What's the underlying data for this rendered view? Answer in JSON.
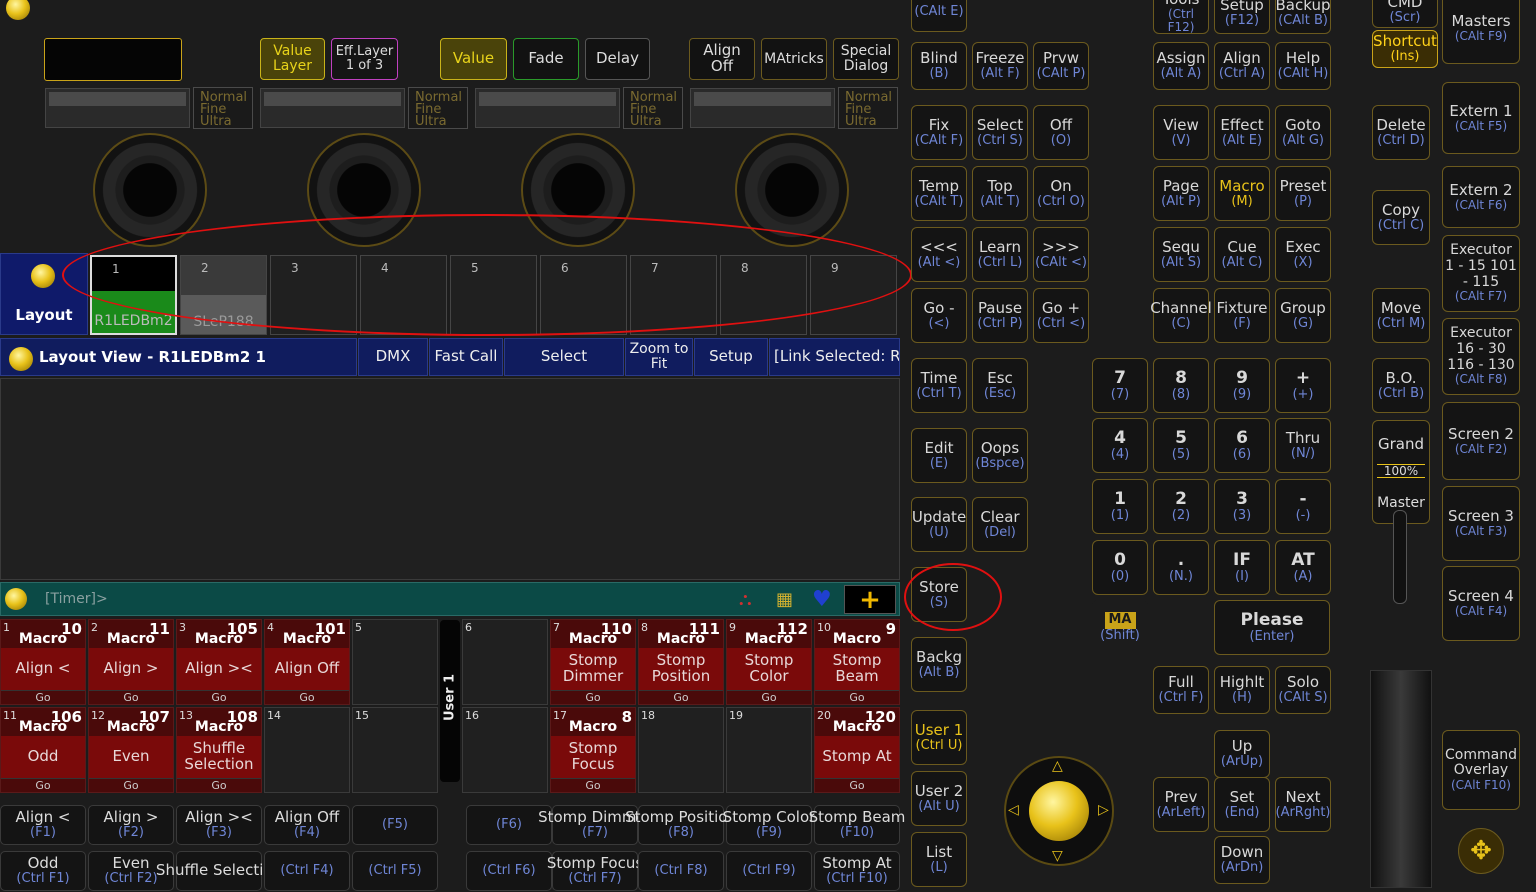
{
  "encoder": {
    "display_box": "",
    "value_layer": "Value Layer",
    "eff_layer": "Eff.Layer 1 of 3",
    "value": "Value",
    "fade": "Fade",
    "delay": "Delay",
    "align_off": "Align Off",
    "matricks": "MAtricks",
    "special_dialog": "Special Dialog",
    "res_text": "Normal Fine Ultra"
  },
  "layout_pool": {
    "label": "Layout",
    "items": [
      {
        "num": "1",
        "name": "R1LEDBm2"
      },
      {
        "num": "2",
        "name": "SLeP188"
      },
      {
        "num": "3",
        "name": ""
      },
      {
        "num": "4",
        "name": ""
      },
      {
        "num": "5",
        "name": ""
      },
      {
        "num": "6",
        "name": ""
      },
      {
        "num": "7",
        "name": ""
      },
      {
        "num": "8",
        "name": ""
      },
      {
        "num": "9",
        "name": ""
      }
    ]
  },
  "layout_view": {
    "title": "Layout View - R1LEDBm2 1",
    "tabs": [
      "DMX",
      "Fast Call",
      "Select",
      "Zoom to Fit",
      "Setup",
      "[Link Selected: R"
    ]
  },
  "executor_bar": {
    "timer": "[Timer]>",
    "user_label": "User 1",
    "row1": [
      {
        "num": "1",
        "id": "10",
        "type": "Macro",
        "action": "Align <",
        "go": "Go"
      },
      {
        "num": "2",
        "id": "11",
        "type": "Macro",
        "action": "Align >",
        "go": "Go"
      },
      {
        "num": "3",
        "id": "105",
        "type": "Macro",
        "action": "Align ><",
        "go": "Go"
      },
      {
        "num": "4",
        "id": "101",
        "type": "Macro",
        "action": "Align Off",
        "go": "Go"
      },
      {
        "num": "5",
        "id": "",
        "type": "",
        "action": "",
        "go": ""
      },
      {
        "num": "6",
        "id": "",
        "type": "",
        "action": "",
        "go": ""
      },
      {
        "num": "7",
        "id": "110",
        "type": "Macro",
        "action": "Stomp Dimmer",
        "go": "Go"
      },
      {
        "num": "8",
        "id": "111",
        "type": "Macro",
        "action": "Stomp Position",
        "go": "Go"
      },
      {
        "num": "9",
        "id": "112",
        "type": "Macro",
        "action": "Stomp Color",
        "go": "Go"
      },
      {
        "num": "10",
        "id": "9",
        "type": "Macro",
        "action": "Stomp Beam",
        "go": "Go"
      }
    ],
    "row2": [
      {
        "num": "11",
        "id": "106",
        "type": "Macro",
        "action": "Odd",
        "go": "Go"
      },
      {
        "num": "12",
        "id": "107",
        "type": "Macro",
        "action": "Even",
        "go": "Go"
      },
      {
        "num": "13",
        "id": "108",
        "type": "Macro",
        "action": "Shuffle Selection",
        "go": "Go"
      },
      {
        "num": "14",
        "id": "",
        "type": "",
        "action": "",
        "go": ""
      },
      {
        "num": "15",
        "id": "",
        "type": "",
        "action": "",
        "go": ""
      },
      {
        "num": "16",
        "id": "",
        "type": "",
        "action": "",
        "go": ""
      },
      {
        "num": "17",
        "id": "8",
        "type": "Macro",
        "action": "Stomp Focus",
        "go": "Go"
      },
      {
        "num": "18",
        "id": "",
        "type": "",
        "action": "",
        "go": ""
      },
      {
        "num": "19",
        "id": "",
        "type": "",
        "action": "",
        "go": ""
      },
      {
        "num": "20",
        "id": "120",
        "type": "Macro",
        "action": "Stomp At",
        "go": "Go"
      }
    ]
  },
  "fkeys": {
    "row1": [
      {
        "l1": "Align <",
        "l2": "(F1)"
      },
      {
        "l1": "Align >",
        "l2": "(F2)"
      },
      {
        "l1": "Align ><",
        "l2": "(F3)"
      },
      {
        "l1": "Align Off",
        "l2": "(F4)"
      },
      {
        "l1": "",
        "l2": "(F5)"
      },
      {
        "l1": "",
        "l2": "(F6)"
      },
      {
        "l1": "Stomp Dimmer",
        "l2": "(F7)"
      },
      {
        "l1": "Stomp Position",
        "l2": "(F8)"
      },
      {
        "l1": "Stomp Color",
        "l2": "(F9)"
      },
      {
        "l1": "Stomp Beam",
        "l2": "(F10)"
      }
    ],
    "row2": [
      {
        "l1": "Odd",
        "l2": "(Ctrl F1)"
      },
      {
        "l1": "Even",
        "l2": "(Ctrl F2)"
      },
      {
        "l1": "Shuffle Selection",
        "l2": ""
      },
      {
        "l1": "",
        "l2": "(Ctrl F4)"
      },
      {
        "l1": "",
        "l2": "(Ctrl F5)"
      },
      {
        "l1": "",
        "l2": "(Ctrl F6)"
      },
      {
        "l1": "Stomp Focus",
        "l2": "(Ctrl F7)"
      },
      {
        "l1": "",
        "l2": "(Ctrl F8)"
      },
      {
        "l1": "",
        "l2": "(Ctrl F9)"
      },
      {
        "l1": "Stomp At",
        "l2": "(Ctrl F10)"
      }
    ]
  },
  "console_keys": [
    {
      "l1": "",
      "l2": "(CAlt E)",
      "gold": false
    },
    {
      "l1": "Blind",
      "l2": "(B)"
    },
    {
      "l1": "Freeze",
      "l2": "(Alt F)"
    },
    {
      "l1": "Prvw",
      "l2": "(CAlt P)"
    },
    {
      "l1": "Fix",
      "l2": "(CAlt F)"
    },
    {
      "l1": "Select",
      "l2": "(Ctrl S)"
    },
    {
      "l1": "Off",
      "l2": "(O)"
    },
    {
      "l1": "Temp",
      "l2": "(CAlt T)"
    },
    {
      "l1": "Top",
      "l2": "(Alt T)"
    },
    {
      "l1": "On",
      "l2": "(Ctrl O)"
    },
    {
      "l1": "<<<",
      "l2": "(Alt <)"
    },
    {
      "l1": "Learn",
      "l2": "(Ctrl L)"
    },
    {
      "l1": ">>>",
      "l2": "(CAlt <)"
    },
    {
      "l1": "Go -",
      "l2": "(<)"
    },
    {
      "l1": "Pause",
      "l2": "(Ctrl P)"
    },
    {
      "l1": "Go +",
      "l2": "(Ctrl <)"
    },
    {
      "l1": "Time",
      "l2": "(Ctrl T)"
    },
    {
      "l1": "Esc",
      "l2": "(Esc)"
    },
    {
      "l1": "Edit",
      "l2": "(E)"
    },
    {
      "l1": "Oops",
      "l2": "(Bspce)"
    },
    {
      "l1": "Update",
      "l2": "(U)"
    },
    {
      "l1": "Clear",
      "l2": "(Del)"
    },
    {
      "l1": "Store",
      "l2": "(S)"
    },
    {
      "l1": "Backg",
      "l2": "(Alt B)"
    },
    {
      "l1": "User 1",
      "l2": "(Ctrl U)"
    },
    {
      "l1": "User 2",
      "l2": "(Alt U)"
    },
    {
      "l1": "List",
      "l2": "(L)"
    },
    {
      "l1": "Tools",
      "l2": "(Ctrl F12)"
    },
    {
      "l1": "Setup",
      "l2": "(F12)"
    },
    {
      "l1": "Backup",
      "l2": "(CAlt B)"
    },
    {
      "l1": "Assign",
      "l2": "(Alt A)"
    },
    {
      "l1": "Align",
      "l2": "(Ctrl A)"
    },
    {
      "l1": "Help",
      "l2": "(CAlt H)"
    },
    {
      "l1": "View",
      "l2": "(V)"
    },
    {
      "l1": "Effect",
      "l2": "(Alt E)"
    },
    {
      "l1": "Goto",
      "l2": "(Alt G)"
    },
    {
      "l1": "Page",
      "l2": "(Alt P)"
    },
    {
      "l1": "Macro",
      "l2": "(M)"
    },
    {
      "l1": "Preset",
      "l2": "(P)"
    },
    {
      "l1": "Sequ",
      "l2": "(Alt S)"
    },
    {
      "l1": "Cue",
      "l2": "(Alt C)"
    },
    {
      "l1": "Exec",
      "l2": "(X)"
    },
    {
      "l1": "Channel",
      "l2": "(C)"
    },
    {
      "l1": "Fixture",
      "l2": "(F)"
    },
    {
      "l1": "Group",
      "l2": "(G)"
    },
    {
      "l1": "7",
      "l2": "(7)"
    },
    {
      "l1": "8",
      "l2": "(8)"
    },
    {
      "l1": "9",
      "l2": "(9)"
    },
    {
      "l1": "+",
      "l2": "(+)"
    },
    {
      "l1": "4",
      "l2": "(4)"
    },
    {
      "l1": "5",
      "l2": "(5)"
    },
    {
      "l1": "6",
      "l2": "(6)"
    },
    {
      "l1": "Thru",
      "l2": "(N/)"
    },
    {
      "l1": "1",
      "l2": "(1)"
    },
    {
      "l1": "2",
      "l2": "(2)"
    },
    {
      "l1": "3",
      "l2": "(3)"
    },
    {
      "l1": "-",
      "l2": "(-)"
    },
    {
      "l1": "0",
      "l2": "(0)"
    },
    {
      "l1": ".",
      "l2": "(N.)"
    },
    {
      "l1": "IF",
      "l2": "(I)"
    },
    {
      "l1": "AT",
      "l2": "(A)"
    },
    {
      "l1": "MA",
      "l2": "(Shift)"
    },
    {
      "l1": "Please",
      "l2": "(Enter)"
    },
    {
      "l1": "Full",
      "l2": "(Ctrl F)"
    },
    {
      "l1": "Highlt",
      "l2": "(H)"
    },
    {
      "l1": "Solo",
      "l2": "(CAlt S)"
    },
    {
      "l1": "Up",
      "l2": "(ArUp)"
    },
    {
      "l1": "Prev",
      "l2": "(ArLeft)"
    },
    {
      "l1": "Set",
      "l2": "(End)"
    },
    {
      "l1": "Next",
      "l2": "(ArRght)"
    },
    {
      "l1": "Down",
      "l2": "(ArDn)"
    },
    {
      "l1": "CMD",
      "l2": "(Scr)"
    },
    {
      "l1": "Shortcut",
      "l2": "(Ins)"
    },
    {
      "l1": "Delete",
      "l2": "(Ctrl D)"
    },
    {
      "l1": "Copy",
      "l2": "(Ctrl C)"
    },
    {
      "l1": "Move",
      "l2": "(Ctrl M)"
    },
    {
      "l1": "B.O.",
      "l2": "(Ctrl B)"
    },
    {
      "l1": "Masters",
      "l2": "(CAlt F9)"
    },
    {
      "l1": "Extern 1",
      "l2": "(CAlt F5)"
    },
    {
      "l1": "Extern 2",
      "l2": "(CAlt F6)"
    },
    {
      "l1": "Executor 1 - 15 101 - 115",
      "l2": "(CAlt F7)"
    },
    {
      "l1": "Executor 16 - 30 116 - 130",
      "l2": "(CAlt F8)"
    },
    {
      "l1": "Screen 2",
      "l2": "(CAlt F2)"
    },
    {
      "l1": "Screen 3",
      "l2": "(CAlt F3)"
    },
    {
      "l1": "Screen 4",
      "l2": "(CAlt F4)"
    },
    {
      "l1": "Command Overlay",
      "l2": "(CAlt F10)"
    }
  ],
  "grand_master": {
    "label_top": "Grand",
    "value": "100%",
    "label_bottom": "Master",
    "level": 1.0
  },
  "colors": {
    "accent": "#e8c21a",
    "tab_blue": "#101c5e",
    "exec_red": "#7a0a0a",
    "highlight_circle": "#e01010"
  }
}
